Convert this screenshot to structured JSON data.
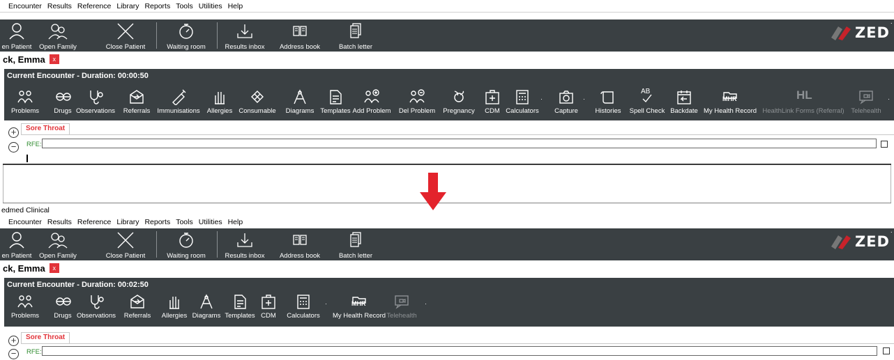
{
  "menu": [
    "Encounter",
    "Results",
    "Reference",
    "Library",
    "Reports",
    "Tools",
    "Utilities",
    "Help"
  ],
  "window_title_partial": "edmed Clinical",
  "main_toolbar": [
    {
      "name": "open-patient",
      "label": "en Patient",
      "icon": "person-icon"
    },
    {
      "name": "open-family",
      "label": "Open Family",
      "icon": "family-icon"
    },
    {
      "name": "close-patient",
      "label": "Close Patient",
      "icon": "close-x-icon"
    },
    {
      "name": "waiting-room",
      "label": "Waiting room",
      "icon": "stopwatch-icon"
    },
    {
      "name": "results-inbox",
      "label": "Results inbox",
      "icon": "inbox-icon"
    },
    {
      "name": "address-book",
      "label": "Address book",
      "icon": "book-icon"
    },
    {
      "name": "batch-letter",
      "label": "Batch letter",
      "icon": "letter-stack-icon"
    }
  ],
  "brand": {
    "text": "ZED"
  },
  "patient": {
    "name_partial": "ck, Emma",
    "close": "x"
  },
  "before": {
    "encounter_title": "Current Encounter - Duration: 00:00:50",
    "buttons": [
      "Problems",
      "Drugs",
      "Observations",
      "Referrals",
      "Immunisations",
      "Allergies",
      "Consumable",
      "Diagrams",
      "Templates",
      "Add Problem",
      "Del Problem",
      "Pregnancy",
      "CDM",
      "Calculators",
      "Capture",
      "Histories",
      "Spell Check",
      "Backdate",
      "My Health Record",
      "HealthLink Forms (Referral)",
      "Telehealth"
    ],
    "mhr_badge": "MHR",
    "hl_badge": "HL",
    "spell_badge": "AB"
  },
  "after": {
    "encounter_title": "Current Encounter - Duration: 00:02:50",
    "buttons": [
      "Problems",
      "Drugs",
      "Observations",
      "Referrals",
      "Allergies",
      "Diagrams",
      "Templates",
      "CDM",
      "Calculators",
      "My Health Record",
      "Telehealth"
    ],
    "mhr_badge": "MHR"
  },
  "tab": {
    "label": "Sore Throat"
  },
  "rfe": {
    "label": "RFE:",
    "value": ""
  },
  "colors": {
    "toolbar_bg": "#3a4043",
    "accent_red": "#e2343a",
    "rfe_green": "#2e8b2e"
  }
}
